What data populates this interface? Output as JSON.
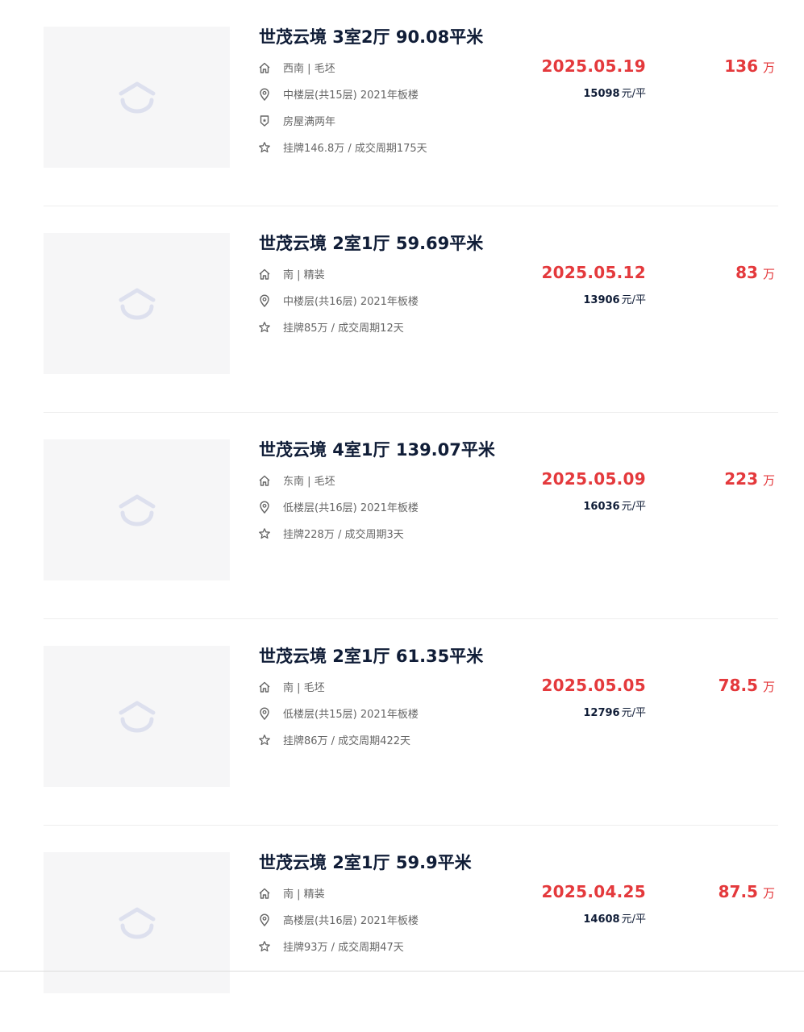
{
  "listings": [
    {
      "title": "世茂云境 3室2厅 90.08平米",
      "orientation_decoration": "西南 | 毛坯",
      "floor_info": "中楼层(共15层) 2021年板楼",
      "tag": "房屋满两年",
      "listing_info": "挂牌146.8万 / 成交周期175天",
      "deal_date": "2025.05.19",
      "unit_price": "15098",
      "unit_price_suffix": "元/平",
      "total_price": "136",
      "total_price_unit": "万"
    },
    {
      "title": "世茂云境 2室1厅 59.69平米",
      "orientation_decoration": "南 | 精装",
      "floor_info": "中楼层(共16层) 2021年板楼",
      "listing_info": "挂牌85万 / 成交周期12天",
      "deal_date": "2025.05.12",
      "unit_price": "13906",
      "unit_price_suffix": "元/平",
      "total_price": "83",
      "total_price_unit": "万"
    },
    {
      "title": "世茂云境 4室1厅 139.07平米",
      "orientation_decoration": "东南 | 毛坯",
      "floor_info": "低楼层(共16层) 2021年板楼",
      "listing_info": "挂牌228万 / 成交周期3天",
      "deal_date": "2025.05.09",
      "unit_price": "16036",
      "unit_price_suffix": "元/平",
      "total_price": "223",
      "total_price_unit": "万"
    },
    {
      "title": "世茂云境 2室1厅 61.35平米",
      "orientation_decoration": "南 | 毛坯",
      "floor_info": "低楼层(共15层) 2021年板楼",
      "listing_info": "挂牌86万 / 成交周期422天",
      "deal_date": "2025.05.05",
      "unit_price": "12796",
      "unit_price_suffix": "元/平",
      "total_price": "78.5",
      "total_price_unit": "万"
    },
    {
      "title": "世茂云境 2室1厅 59.9平米",
      "orientation_decoration": "南 | 精装",
      "floor_info": "高楼层(共16层) 2021年板楼",
      "listing_info": "挂牌93万 / 成交周期47天",
      "deal_date": "2025.04.25",
      "unit_price": "14608",
      "unit_price_suffix": "元/平",
      "total_price": "87.5",
      "total_price_unit": "万"
    }
  ],
  "icons": {
    "house": "house-icon",
    "location": "location-pin-icon",
    "shield": "shield-badge-icon",
    "star": "star-icon",
    "placeholder": "image-placeholder-icon"
  },
  "colors": {
    "price_red": "#e4393c",
    "title_navy": "#101d37",
    "meta_gray": "#666666",
    "thumb_bg": "#f6f6f7",
    "placeholder_icon": "#dde0ee"
  }
}
